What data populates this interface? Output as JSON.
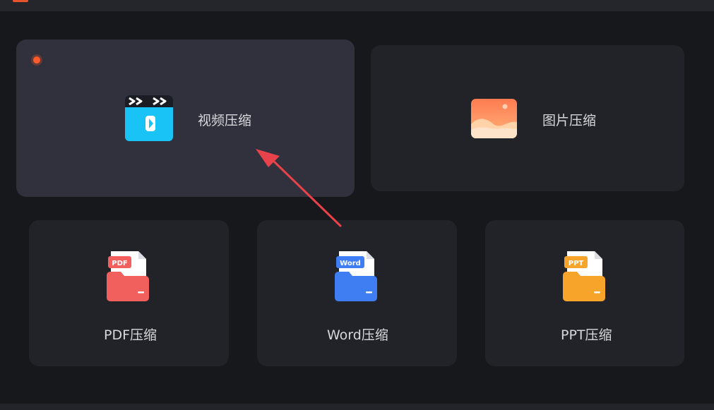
{
  "cards": {
    "video": {
      "label": "视频压缩",
      "icon": "video-clapper-icon",
      "selected": true,
      "badge": "notification-dot"
    },
    "image": {
      "label": "图片压缩",
      "icon": "image-landscape-icon"
    },
    "pdf": {
      "label": "PDF压缩",
      "icon": "pdf-folder-icon",
      "tag": "PDF"
    },
    "word": {
      "label": "Word压缩",
      "icon": "word-folder-icon",
      "tag": "Word"
    },
    "ppt": {
      "label": "PPT压缩",
      "icon": "ppt-folder-icon",
      "tag": "PPT"
    }
  },
  "annotation": {
    "icon": "red-arrow-pointer",
    "color": "#e8424a"
  },
  "colors": {
    "background": "#17181b",
    "card": "#222328",
    "card_active": "#30313d",
    "video_icon": "#19c3f5",
    "pdf": "#f2605d",
    "word": "#3f7ef2",
    "ppt": "#f7a52a",
    "badge": "#ff5a2a"
  }
}
